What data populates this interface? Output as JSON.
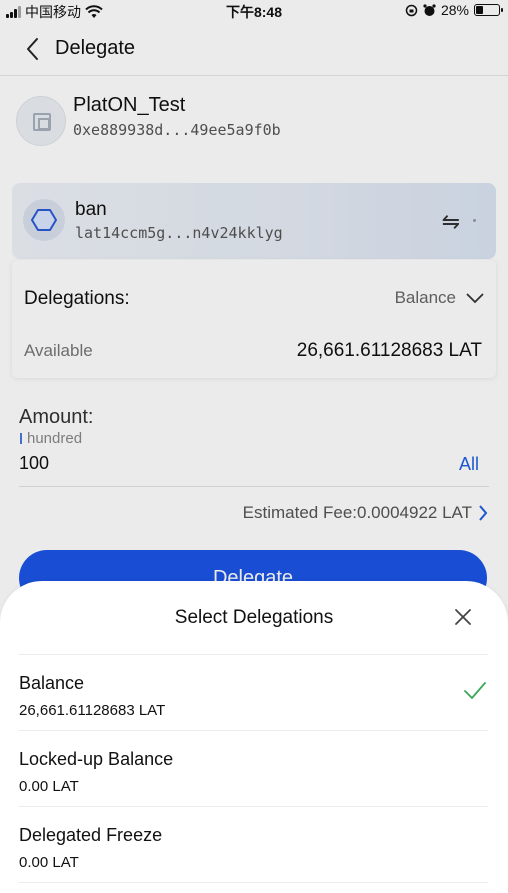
{
  "status_bar": {
    "carrier": "中国移动",
    "time": "下午8:48",
    "battery_percent": "28%"
  },
  "nav": {
    "title": "Delegate",
    "back_icon": "chevron-left-icon"
  },
  "wallet": {
    "name": "PlatON_Test",
    "address": "0xe889938d...49ee5a9f0b"
  },
  "node": {
    "name": "ban",
    "address": "lat14ccm5g...n4v24kklyg",
    "switch_icon": "swap-arrows-icon"
  },
  "delegations": {
    "label": "Delegations:",
    "selected": "Balance",
    "available_label": "Available",
    "available_value": "26,661.61128683 LAT"
  },
  "amount": {
    "label": "Amount:",
    "hint": "hundred",
    "value": "100",
    "all_label": "All"
  },
  "fee": {
    "text": "Estimated Fee:0.0004922 LAT"
  },
  "delegate_button": {
    "label": "Delegate"
  },
  "sheet": {
    "title": "Select Delegations",
    "options": [
      {
        "name": "Balance",
        "amount": "26,661.61128683 LAT",
        "selected": true
      },
      {
        "name": "Locked-up Balance",
        "amount": "0.00 LAT",
        "selected": false
      },
      {
        "name": "Delegated Freeze",
        "amount": "0.00 LAT",
        "selected": false
      }
    ]
  },
  "colors": {
    "accent": "#1c55e6",
    "check": "#3aa85a",
    "link": "#1e5fe3"
  }
}
